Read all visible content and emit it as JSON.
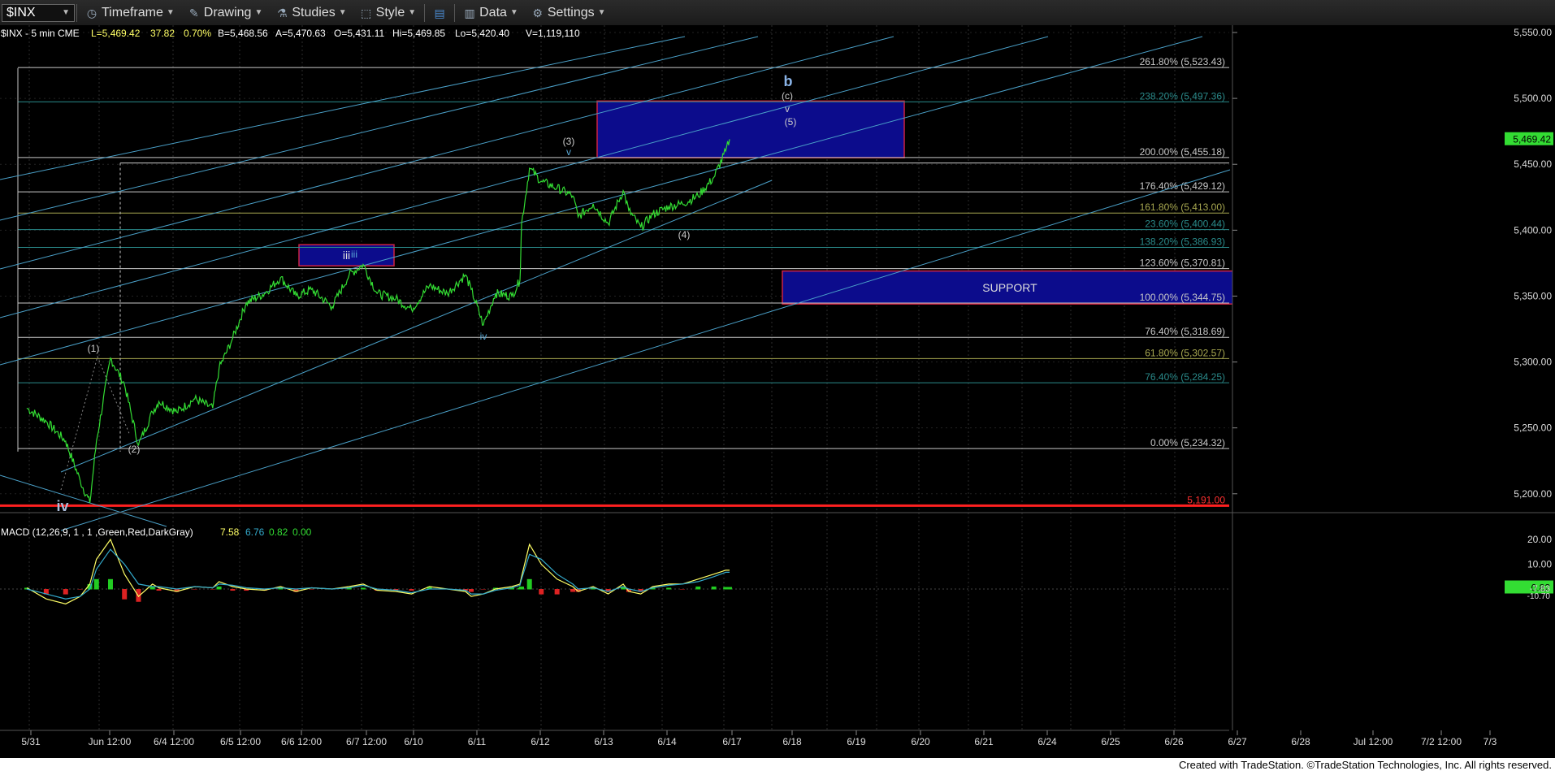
{
  "toolbar": {
    "symbol": "$INX",
    "items": [
      {
        "label": "Timeframe",
        "icon": "clock-icon"
      },
      {
        "label": "Drawing",
        "icon": "pencil-icon"
      },
      {
        "label": "Studies",
        "icon": "flask-icon"
      },
      {
        "label": "Style",
        "icon": "style-icon"
      },
      {
        "label": "",
        "icon": "layout-icon"
      },
      {
        "label": "Data",
        "icon": "bars-icon"
      },
      {
        "label": "Settings",
        "icon": "gear-icon"
      }
    ]
  },
  "header": {
    "symbol_info": "$INX - 5 min  CME",
    "last": "L=5,469.42",
    "change": "37.82",
    "pct": "0.70%",
    "bid": "B=5,468.56",
    "ask": "A=5,470.63",
    "open": "O=5,431.11",
    "high": "Hi=5,469.85",
    "low": "Lo=5,420.40",
    "volume": "V=1,119,110"
  },
  "chart_data": {
    "type": "line",
    "series": [
      {
        "name": "$INX",
        "x": [
          "5/31 08:30",
          "5/31 10:30",
          "5/31 12:30",
          "5/31 14:00",
          "5/31 15:00",
          "6/3 09:00",
          "6/3 10:30",
          "6/3 12:00",
          "6/3 13:30",
          "6/3 15:00",
          "6/4 09:00",
          "6/4 11:00",
          "6/4 13:00",
          "6/4 15:00",
          "6/5 09:00",
          "6/5 10:30",
          "6/5 12:00",
          "6/5 14:00",
          "6/6 09:00",
          "6/6 10:30",
          "6/6 12:00",
          "6/6 14:00",
          "6/7 09:00",
          "6/7 10:30",
          "6/7 12:00",
          "6/7 14:00",
          "6/10 09:00",
          "6/10 11:00",
          "6/10 13:00",
          "6/10 15:00",
          "6/11 09:00",
          "6/11 10:30",
          "6/11 12:00",
          "6/11 14:00",
          "6/11 15:00",
          "6/12 08:30",
          "6/12 09:30",
          "6/12 11:00",
          "6/12 13:00",
          "6/12 15:00",
          "6/13 09:00",
          "6/13 11:00",
          "6/13 13:00",
          "6/13 15:00",
          "6/14 09:00",
          "6/14 10:30",
          "6/14 12:00",
          "6/14 14:00",
          "6/17 09:00",
          "6/17 11:00",
          "6/17 13:00",
          "6/17 14:30",
          "6/17 15:00"
        ],
        "values": [
          5265,
          5255,
          5240,
          5210,
          5193,
          5240,
          5303,
          5283,
          5237,
          5262,
          5270,
          5262,
          5272,
          5265,
          5295,
          5318,
          5345,
          5352,
          5364,
          5350,
          5355,
          5342,
          5366,
          5374,
          5352,
          5348,
          5340,
          5358,
          5352,
          5366,
          5355,
          5328,
          5352,
          5350,
          5362,
          5405,
          5447,
          5437,
          5432,
          5426,
          5410,
          5420,
          5405,
          5430,
          5415,
          5402,
          5412,
          5418,
          5420,
          5426,
          5440,
          5460,
          5469
        ]
      },
      {
        "name": "MACD",
        "values": [
          0.5,
          -4,
          -6,
          -3,
          2,
          12,
          20,
          6,
          -3,
          2,
          0.5,
          -1,
          1,
          0.5,
          3,
          1,
          0,
          -0.5,
          1,
          -1,
          0.5,
          0,
          1,
          2,
          -0.5,
          -1,
          -2,
          1,
          0,
          -1,
          -3,
          -2,
          0,
          1,
          2,
          5,
          18,
          10,
          4,
          1,
          -1,
          1,
          -2,
          2,
          -1,
          -2,
          1,
          2,
          2,
          4,
          6,
          7.58,
          7.58
        ]
      },
      {
        "name": "MACDAvg",
        "values": [
          0,
          -2,
          -4,
          -3,
          0,
          8,
          16,
          10,
          2,
          1,
          1,
          0,
          1,
          0.5,
          2,
          1.5,
          0.5,
          0,
          0.5,
          0,
          0.5,
          0,
          0.5,
          1.5,
          0,
          -0.5,
          -1.5,
          0,
          0,
          -0.5,
          -2,
          -2,
          -0.5,
          0.5,
          1.5,
          4,
          14,
          12,
          6,
          2,
          0,
          0.5,
          -1,
          1,
          0,
          -1,
          0.5,
          1.5,
          2,
          3,
          5,
          6.76,
          6.76
        ]
      }
    ],
    "title": "",
    "xlabel": "",
    "ylabel": "",
    "ylim": [
      5170,
      5553
    ],
    "y_ticks": [
      "5,550.00",
      "5,500.00",
      "5,450.00",
      "5,400.00",
      "5,350.00",
      "5,300.00",
      "5,250.00",
      "5,200.00"
    ],
    "x_tick_labels": [
      "5/31",
      "Jun 12:00",
      "6/4 12:00",
      "6/5 12:00",
      "6/6 12:00",
      "6/7 12:00",
      "6/10",
      "6/11",
      "6/12",
      "6/13",
      "6/14",
      "6/17",
      "6/18",
      "6/19",
      "6/20",
      "6/21",
      "6/24",
      "6/25",
      "6/26",
      "6/27",
      "6/28",
      "Jul 12:00",
      "7/2 12:00",
      "7/3"
    ],
    "last_price_tag": "5,469.42",
    "fib_levels": [
      {
        "label": "261.80% (5,523.43)",
        "value": 5523.43,
        "color": "#c8c8c8"
      },
      {
        "label": "238.20% (5,497.36)",
        "value": 5497.36,
        "color": "#2a8a8a"
      },
      {
        "label": "200.00% (5,455.18)",
        "value": 5455.18,
        "color": "#c8c8c8"
      },
      {
        "label": "176.40% (5,429.12)",
        "value": 5429.12,
        "color": "#c8c8c8"
      },
      {
        "label": "161.80% (5,413.00)",
        "value": 5413.0,
        "color": "#a8a850"
      },
      {
        "label": "23.60% (5,400.44)",
        "value": 5400.44,
        "color": "#2a8a8a"
      },
      {
        "label": "138.20% (5,386.93)",
        "value": 5386.93,
        "color": "#2a8a8a"
      },
      {
        "label": "123.60% (5,370.81)",
        "value": 5370.81,
        "color": "#c8c8c8"
      },
      {
        "label": "100.00% (5,344.75)",
        "value": 5344.75,
        "color": "#c8c8c8"
      },
      {
        "label": "76.40% (5,318.69)",
        "value": 5318.69,
        "color": "#c8c8c8"
      },
      {
        "label": "61.80% (5,302.57)",
        "value": 5302.57,
        "color": "#a8a850"
      },
      {
        "label": "76.40% (5,284.25)",
        "value": 5284.25,
        "color": "#2a8a8a"
      },
      {
        "label": "0.00% (5,234.32)",
        "value": 5234.32,
        "color": "#c8c8c8"
      },
      {
        "label": "5,191.00",
        "value": 5191.0,
        "color": "#ff2020"
      }
    ],
    "zones": [
      {
        "label": "",
        "y1": 5455,
        "y2": 5498
      },
      {
        "label": "SUPPORT",
        "y1": 5344,
        "y2": 5369
      },
      {
        "label": "iii",
        "y1": 5373,
        "y2": 5389
      }
    ],
    "wave_labels": [
      {
        "text": "b",
        "style": "big"
      },
      {
        "text": "(c)",
        "style": "small"
      },
      {
        "text": "v",
        "style": "small"
      },
      {
        "text": "(5)",
        "style": "small"
      },
      {
        "text": "(3)",
        "style": "small"
      },
      {
        "text": "v",
        "style": "small"
      },
      {
        "text": "(4)",
        "style": "small"
      },
      {
        "text": "iii",
        "style": "small"
      },
      {
        "text": "iv",
        "style": "small"
      },
      {
        "text": "(1)",
        "style": "small"
      },
      {
        "text": "(2)",
        "style": "small"
      },
      {
        "text": "iv",
        "style": "big"
      }
    ]
  },
  "macd": {
    "label": "MACD (12,26,9, 1 , 1 ,Green,Red,DarkGray)",
    "v1": "7.58",
    "v2": "6.76",
    "v3": "0.82",
    "v4": "0.00",
    "y_ticks": [
      "20.00",
      "10.00"
    ],
    "tag": "0.82",
    "neg_ticks": [
      "-7.83",
      "-10.70"
    ]
  },
  "colors": {
    "price": "#33dd33",
    "zone_fill": "#0c0c8c",
    "zone_border": "#cc2244",
    "channel": "#4aa0c8",
    "macd_line": "#ffff66",
    "macd_avg": "#33aacc"
  },
  "footer": "Created with TradeStation. ©TradeStation Technologies, Inc. All rights reserved."
}
